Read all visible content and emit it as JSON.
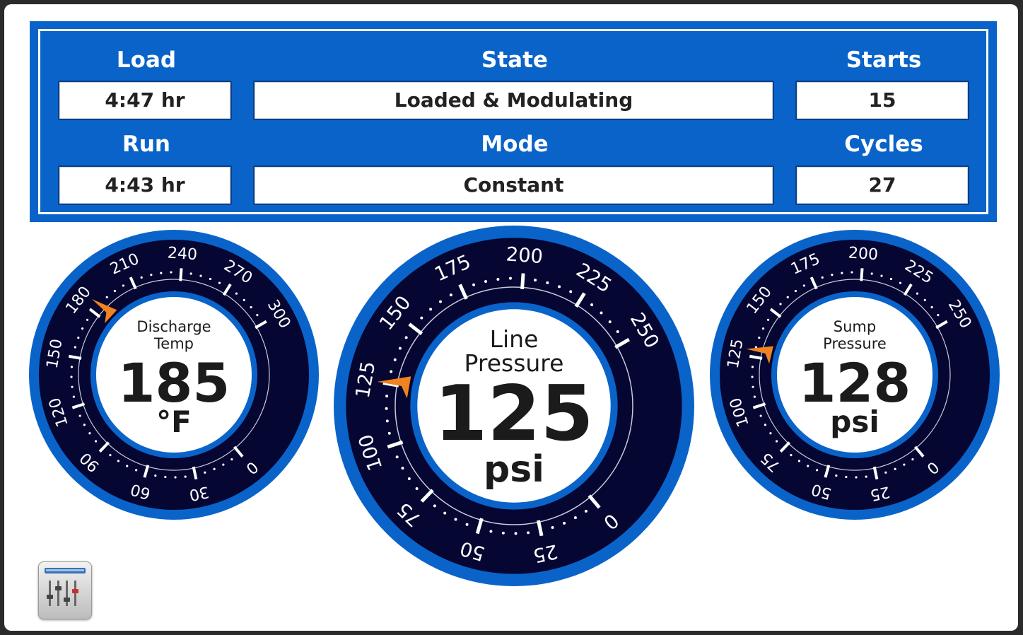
{
  "status": {
    "load": {
      "label": "Load",
      "value": "4:47 hr"
    },
    "state": {
      "label": "State",
      "value": "Loaded & Modulating"
    },
    "starts": {
      "label": "Starts",
      "value": "15"
    },
    "run": {
      "label": "Run",
      "value": "4:43 hr"
    },
    "mode": {
      "label": "Mode",
      "value": "Constant"
    },
    "cycles": {
      "label": "Cycles",
      "value": "27"
    }
  },
  "gauges": {
    "discharge": {
      "title_line1": "Discharge",
      "title_line2": "Temp",
      "value": "185",
      "unit": "°F",
      "reading": 185,
      "ticks": [
        "0",
        "30",
        "60",
        "90",
        "120",
        "150",
        "180",
        "210",
        "240",
        "270",
        "300"
      ],
      "min": 0,
      "max": 300
    },
    "line": {
      "title_line1": "Line",
      "title_line2": "Pressure",
      "value": "125",
      "unit": "psi",
      "reading": 125,
      "ticks": [
        "0",
        "25",
        "50",
        "75",
        "100",
        "125",
        "150",
        "175",
        "200",
        "225",
        "250"
      ],
      "min": 0,
      "max": 250
    },
    "sump": {
      "title_line1": "Sump",
      "title_line2": "Pressure",
      "value": "128",
      "unit": "psi",
      "reading": 128,
      "ticks": [
        "0",
        "25",
        "50",
        "75",
        "100",
        "125",
        "150",
        "175",
        "200",
        "225",
        "250"
      ],
      "min": 0,
      "max": 250
    }
  },
  "colors": {
    "panel_blue": "#0a63c9",
    "dial_navy": "#050632",
    "pointer_orange": "#f0831f"
  },
  "icons": {
    "settings_app": "mixer-settings-icon"
  }
}
